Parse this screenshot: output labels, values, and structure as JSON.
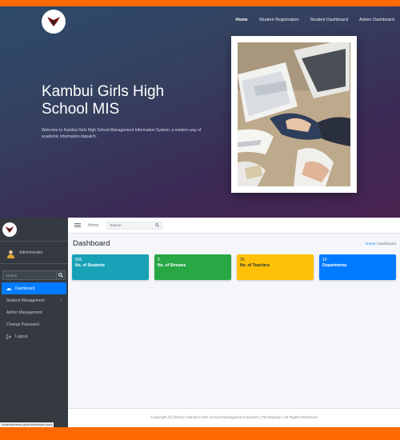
{
  "colors": {
    "accent_orange": "#ff6a00",
    "sidebar_bg": "#343a40",
    "primary": "#007bff",
    "info": "#17a2b8",
    "success": "#28a745",
    "warning": "#ffc107"
  },
  "hero": {
    "logo_icon": "school-crest-icon",
    "nav": [
      "Home",
      "Student Registration",
      "Student Dashboard",
      "Admin Dashboard"
    ],
    "title": "Kambui Girls High School MIS",
    "text": "Welcome to Kambui Girls High School Management Information System, a modern way of academic information dispatch.",
    "image_icon": "business-handshake-photo"
  },
  "sidebar": {
    "user_name": "Administrator",
    "search_placeholder": "Search",
    "items": [
      {
        "label": "Dashboard",
        "icon": "dashboard-icon"
      },
      {
        "label": "Student Management",
        "icon": ""
      },
      {
        "label": "Admin Management",
        "icon": ""
      },
      {
        "label": "Change Password",
        "icon": ""
      },
      {
        "label": "Logout",
        "icon": "logout-icon"
      }
    ],
    "status_url": "localhost/kambu.girls/Admin/index.php#"
  },
  "topbar": {
    "home": "Home",
    "search_placeholder": "Search"
  },
  "content": {
    "title": "Dashboard",
    "breadcrumb_home": "Home",
    "breadcrumb_sep": "/",
    "breadcrumb_current": "Dashboard",
    "boxes": [
      {
        "value": "830",
        "label": "No. of Students",
        "color": "#17a2b8"
      },
      {
        "value": "5",
        "label": "No. of Streams",
        "color": "#28a745"
      },
      {
        "value": "25",
        "label": "No. of Teachers",
        "color": "#ffc107"
      },
      {
        "value": "10",
        "label": "Departments",
        "color": "#007bff"
      }
    ]
  },
  "footer": {
    "text": "Copyright @ [2024] | Kambui Girls School Management System | Techstacity | All Rights Reserved"
  }
}
